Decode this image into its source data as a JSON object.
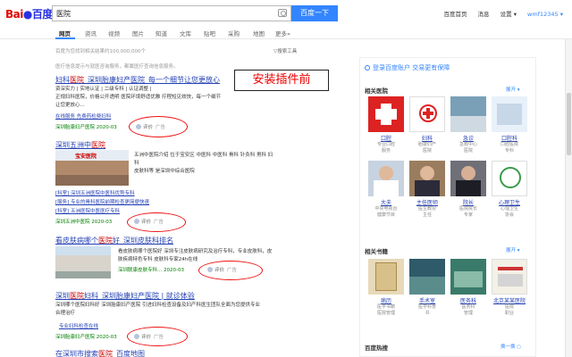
{
  "header": {
    "logo_bai": "Bai",
    "logo_paw": "●",
    "logo_du": "百度",
    "search_query": "医院",
    "search_button": "百度一下",
    "top_links": [
      "百度首页",
      "消息",
      "设置 ▾"
    ],
    "user": "wmf12345 ▾"
  },
  "tabs": [
    "网页",
    "资讯",
    "视频",
    "图片",
    "知道",
    "文库",
    "贴吧",
    "采购",
    "地图",
    "更多»"
  ],
  "results_meta": {
    "count": "百度为您找到相关结果约100,000,000个",
    "tools": "▽搜索工具",
    "notice": "医疗信息提示与就医咨询服务，都属医疗查询信息服务。"
  },
  "annotation": "安装插件前",
  "results": [
    {
      "title_pre": "妇科",
      "title_em": "医院",
      "title_post": "_深圳胎康妇产医院_每一个细节让您更放心",
      "lines": [
        "资深实力 | 实地认证 | 二级专科 | 认证调整 |",
        "正规妇科医院，价格公开透明 医院环境舒适优雅 疗程短见效快，每一个细节",
        "让您更放心..."
      ],
      "link": "在线服务  先费药检费妇科",
      "source": "深圳胎康妇产医院  2020-03  ",
      "eval": "评价",
      "ad": "广告"
    },
    {
      "title_pre": "深圳五洲中",
      "title_em": "医院",
      "title_post": "",
      "brand": "宝安医院",
      "lines": [
        "五洲中医院介绍 位于宝安区 中医科 中医科 骨科 针灸科 男科 妇科",
        "皮肤科等 是深圳中综合医院"
      ],
      "sublinks": [
        "[科室] 深圳五洲医院中医科优势专科",
        "[服务] 专业的骨科医院前期检查更简便快速",
        "[科室] 五洲医院中医医疗专科"
      ],
      "source": "深圳五洲中医院  2020-03  ",
      "eval": "评价",
      "ad": "广告"
    },
    {
      "title_pre": "看皮肤病哪个",
      "title_em": "医院",
      "title_post": "好_深圳皮肤科排名",
      "lines": [
        "看皮肤病哪个医院好 深圳专注皮肤病研究及治疗专科，专业皮肤科，皮",
        "肤疾病特色专科 皮肤科专家24h在线"
      ],
      "source": "深圳联康皮肤专科...  2020-03  ",
      "eval": "评价",
      "ad": "广告"
    },
    {
      "title_pre": "深圳",
      "title_em": "医院",
      "title_post": "妇科_深圳胎康妇产医院 | 就诊体验",
      "lines": [
        "深圳哪个医院妇科好 深圳胎康妇产医院 引进妇科检查设备及妇产科医生团队全面为您提供专业",
        "合理治疗"
      ],
      "link": "专业妇科检查在线",
      "source": "深圳胎康妇产医院  2020-03  ",
      "eval": "评价",
      "ad": "广告"
    },
    {
      "title_pre": "在深圳市搜索",
      "title_em": "医院",
      "title_post": "_百度地图"
    }
  ],
  "right": {
    "login": "登录百度账户  交易更有保障",
    "section1": "相关医院",
    "section1_more": "展开 ▾",
    "hospitals": [
      {
        "name": "口腔",
        "desc": "专业口腔\n服务"
      },
      {
        "name": "妇科",
        "desc": "胎康妇产\n医院"
      },
      {
        "name": "急诊",
        "desc": "急救中心\n医院"
      },
      {
        "name": "口腔科",
        "desc": "口腔医院\n专科"
      }
    ],
    "people": [
      {
        "name": "大夫",
        "desc": "中央电视台\n健康节目"
      },
      {
        "name": "主任医师",
        "desc": "医生教授\n主任"
      },
      {
        "name": "院长",
        "desc": "医院院长\n专家"
      },
      {
        "name": "心理卫生",
        "desc": "心理卫生\n协会"
      }
    ],
    "section2": "相关书籍",
    "section2_more": "展开 ▾",
    "books": [
      {
        "name": "病历",
        "desc": "医学书籍\n医院管理"
      },
      {
        "name": "手术室",
        "desc": "医学科普\n书"
      },
      {
        "name": "医务科",
        "desc": "医务科\n管理"
      },
      {
        "name": "北京某某医院",
        "desc": "医院\n职业"
      }
    ],
    "hot": "百度热搜",
    "hot_refresh": "换一换 ○"
  },
  "colors": {
    "accent": "#3385ff",
    "link": "#2440b3",
    "highlight": "#cc0000",
    "annotation_red": "#ee1111",
    "logo_red": "#e10602",
    "logo_blue": "#2932e1"
  }
}
